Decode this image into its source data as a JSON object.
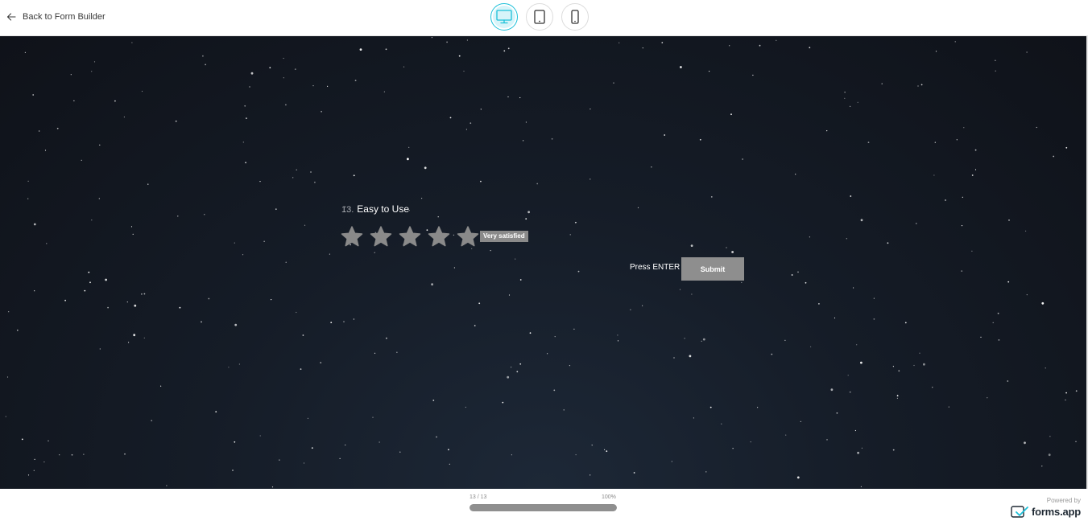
{
  "header": {
    "back_label": "Back to Form Builder",
    "devices": [
      {
        "name": "desktop",
        "icon": "monitor-icon",
        "active": true
      },
      {
        "name": "tablet",
        "icon": "tablet-icon",
        "active": false
      },
      {
        "name": "mobile",
        "icon": "phone-icon",
        "active": false
      }
    ],
    "accent_color": "#1cc0d9"
  },
  "question": {
    "number": "13.",
    "title": "Easy to Use",
    "stars": 5,
    "hover_label": "Very satisfied"
  },
  "actions": {
    "hint": "Press ENTER",
    "submit_label": "Submit"
  },
  "progress": {
    "counter": "13 / 13",
    "percent_label": "100%",
    "fraction": 1.0
  },
  "branding": {
    "powered_by": "Powered by",
    "name": "forms.app"
  }
}
